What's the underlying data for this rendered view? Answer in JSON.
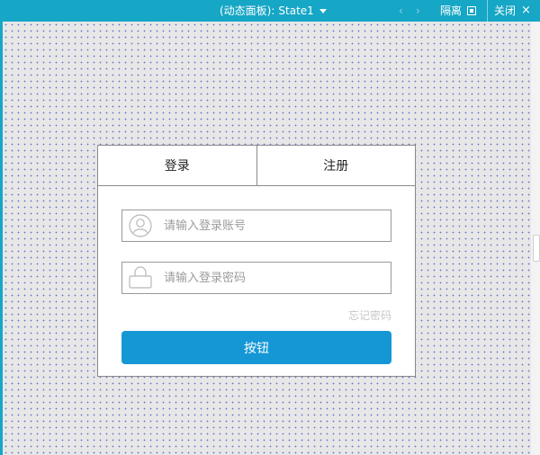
{
  "topbar": {
    "panel_label": "(动态面板):",
    "state": "State1",
    "prev_arrow": "‹",
    "next_arrow": "›",
    "isolate_label": "隔离",
    "close_label": "关闭",
    "close_icon": "×"
  },
  "login": {
    "tabs": [
      {
        "label": "登录"
      },
      {
        "label": "注册"
      }
    ],
    "username": {
      "placeholder": "请输入登录账号",
      "value": ""
    },
    "password": {
      "placeholder": "请输入登录密码",
      "value": ""
    },
    "forgot_label": "忘记密码",
    "button_label": "按钮"
  },
  "colors": {
    "accent": "#16a6c6",
    "button": "#1597d6",
    "grid_dot": "#6d72c4"
  }
}
